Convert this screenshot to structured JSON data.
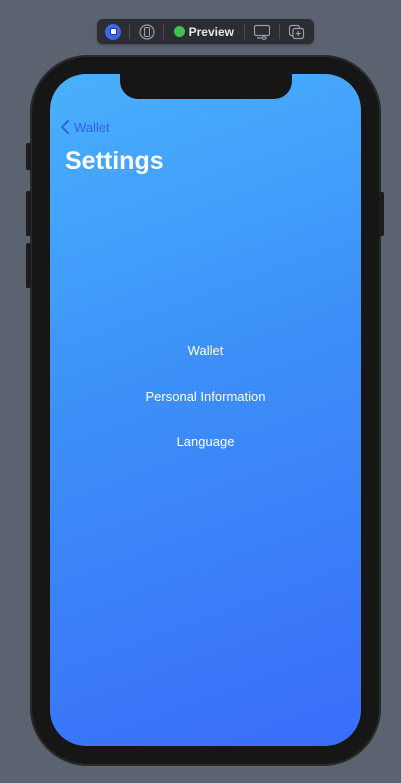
{
  "toolbar": {
    "preview_label": "Preview",
    "icons": [
      "live-preview-icon",
      "device-icon",
      "preview-status-icon",
      "device-settings-icon",
      "duplicate-icon"
    ],
    "status_color": "#3ac34f",
    "accent_color": "#3e67e6"
  },
  "app": {
    "nav": {
      "back_label": "Wallet",
      "back_icon": "chevron-left-icon",
      "back_color": "#3b5cf0"
    },
    "title": "Settings",
    "menu": [
      {
        "label": "Wallet"
      },
      {
        "label": "Personal Information"
      },
      {
        "label": "Language"
      }
    ],
    "gradient": [
      "#49b1fd",
      "#3a6df9"
    ]
  }
}
